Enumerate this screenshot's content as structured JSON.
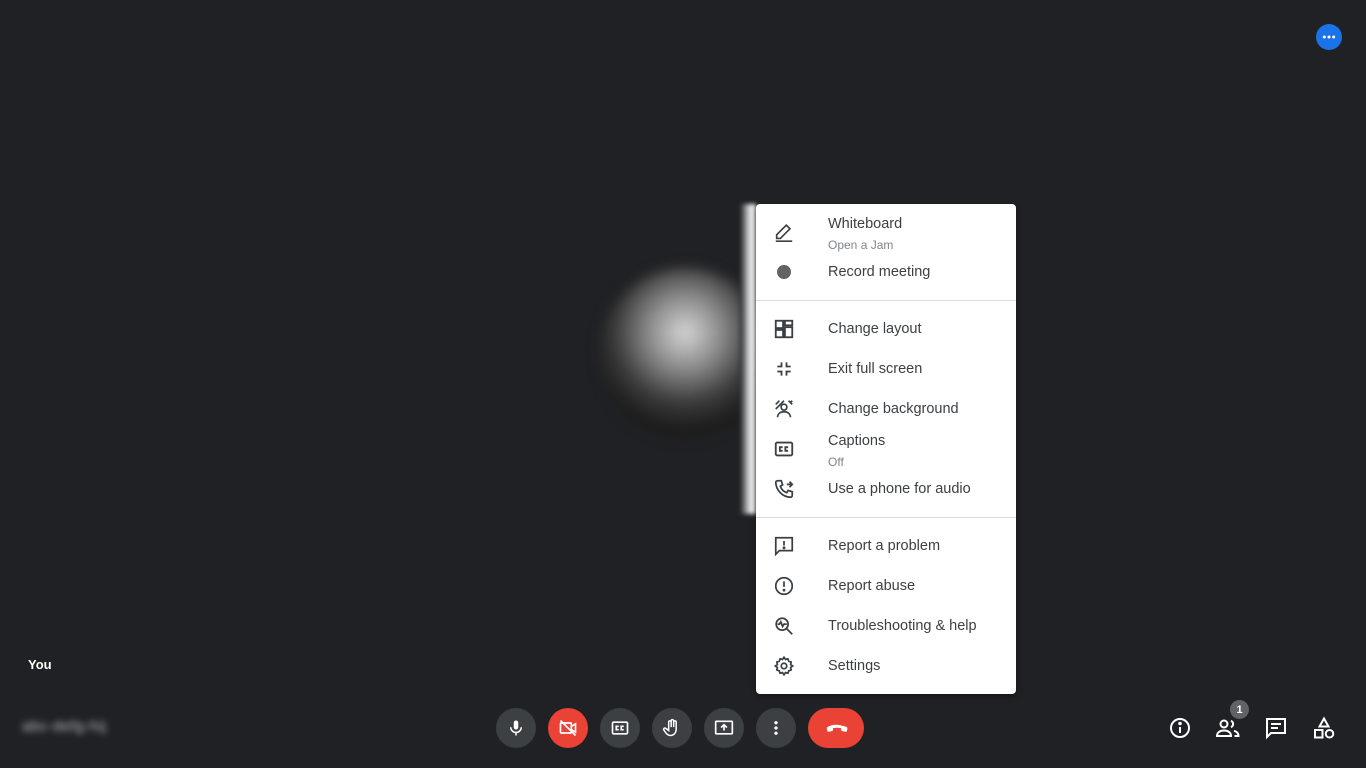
{
  "top": {
    "more_options_icon": "more-horiz-icon",
    "accent": "#1a73e8"
  },
  "participant": {
    "self_label": "You",
    "meeting_code": "abc-defg-hij"
  },
  "menu": {
    "groups": [
      [
        {
          "label": "Whiteboard",
          "sublabel": "Open a Jam",
          "icon": "pen-icon"
        },
        {
          "label": "Record meeting",
          "icon": "record-icon"
        }
      ],
      [
        {
          "label": "Change layout",
          "icon": "layout-icon"
        },
        {
          "label": "Exit full screen",
          "icon": "exit-fullscreen-icon"
        },
        {
          "label": "Change background",
          "icon": "background-icon"
        },
        {
          "label": "Captions",
          "sublabel": "Off",
          "icon": "captions-icon"
        },
        {
          "label": "Use a phone for audio",
          "icon": "phone-forward-icon"
        }
      ],
      [
        {
          "label": "Report a problem",
          "icon": "feedback-icon"
        },
        {
          "label": "Report abuse",
          "icon": "report-icon"
        },
        {
          "label": "Troubleshooting & help",
          "icon": "troubleshoot-icon"
        },
        {
          "label": "Settings",
          "icon": "settings-icon"
        }
      ]
    ]
  },
  "controls": {
    "mic": {
      "icon": "mic-icon"
    },
    "camera": {
      "icon": "camera-off-icon",
      "color": "#ea4335"
    },
    "captions": {
      "icon": "captions-icon"
    },
    "raise_hand": {
      "icon": "hand-icon"
    },
    "present": {
      "icon": "present-icon"
    },
    "more": {
      "icon": "more-vert-icon"
    },
    "hangup": {
      "icon": "call-end-icon",
      "color": "#ea4335"
    }
  },
  "side": {
    "info_icon": "info-icon",
    "people_icon": "people-icon",
    "people_count": "1",
    "chat_icon": "chat-icon",
    "activities_icon": "activities-icon"
  }
}
